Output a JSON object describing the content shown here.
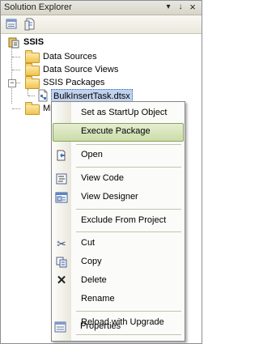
{
  "window": {
    "title": "Solution Explorer",
    "pin_glyph": "↓",
    "close_glyph": "×",
    "dropdown_glyph": "▾"
  },
  "toolbar": {
    "buttons": [
      "properties-icon",
      "show-all-files-icon"
    ]
  },
  "tree": {
    "root": "SSIS",
    "items": [
      {
        "label": "Data Sources",
        "icon": "folder-icon"
      },
      {
        "label": "Data Source Views",
        "icon": "folder-icon"
      },
      {
        "label": "SSIS Packages",
        "icon": "folder-icon",
        "expanded": true
      },
      {
        "label": "BulkInsertTask.dtsx",
        "icon": "package-file-icon",
        "selected": true
      },
      {
        "label": "Mi",
        "icon": "folder-icon"
      }
    ],
    "collapse_glyph": "−"
  },
  "context_menu": {
    "items": [
      {
        "label": "Set as StartUp Object",
        "icon": ""
      },
      {
        "label": "Execute Package",
        "icon": "",
        "highlighted": true
      },
      {
        "label": "Open",
        "icon": "open-icon"
      },
      {
        "label": "View Code",
        "icon": "view-code-icon"
      },
      {
        "label": "View Designer",
        "icon": "view-designer-icon"
      },
      {
        "label": "Exclude From Project",
        "icon": ""
      },
      {
        "label": "Cut",
        "icon": "cut-icon"
      },
      {
        "label": "Copy",
        "icon": "copy-icon"
      },
      {
        "label": "Delete",
        "icon": "delete-icon"
      },
      {
        "label": "Rename",
        "icon": ""
      },
      {
        "label": "Reload with Upgrade",
        "icon": ""
      },
      {
        "label": "Properties",
        "icon": "properties-icon"
      }
    ],
    "delete_glyph": "✕",
    "cut_glyph": "✂"
  }
}
